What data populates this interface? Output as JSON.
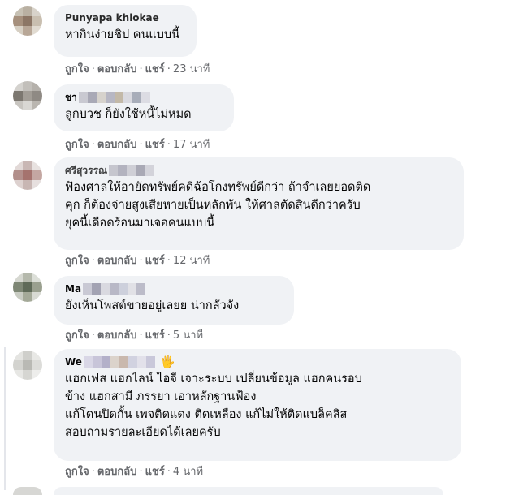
{
  "comments": [
    {
      "name_partial": "Punyapa khlokae",
      "text": "หากินง่ายชิป คนแบบนี้",
      "actions": {
        "like": "ถูกใจ",
        "reply": "ตอบกลับ",
        "share": "แชร์",
        "time": "23 นาที",
        "sep": "·"
      }
    },
    {
      "name_partial": "ชา",
      "text": "ลูกบวช ก็ยังใช้หนี้ไม่หมด",
      "actions": {
        "like": "ถูกใจ",
        "reply": "ตอบกลับ",
        "share": "แชร์",
        "time": "17 นาที",
        "sep": "·"
      }
    },
    {
      "name_partial": "ศรีสุวรรณ",
      "text": "ฟ้องศาลให้อายัดทรัพย์คดีฉ้อโกงทรัพย์ดีกว่า ถ้าจำเลยยอดติด\nคุก ก็ต้องจ่ายสูงเสียหายเป็นหลักพัน ให้ศาลตัดสินดีกว่าครับ\nยุคนี้เดือดร้อนมาเจอคนแบบนี้",
      "actions": {
        "like": "ถูกใจ",
        "reply": "ตอบกลับ",
        "share": "แชร์",
        "time": "12 นาที",
        "sep": "·"
      }
    },
    {
      "name_partial": "Ma",
      "text": "ยังเห็นโพสต์ขายอยู่เลยย น่ากลัวจัง",
      "actions": {
        "like": "ถูกใจ",
        "reply": "ตอบกลับ",
        "share": "แชร์",
        "time": "5 นาที",
        "sep": "·"
      }
    },
    {
      "name_partial": "We",
      "text": "แฮกเฟส แฮกไลน์ ไอจี เจาะระบบ เปลี่ยนข้อมูล แฮกคนรอบ\nข้าง แฮกสามี ภรรยา เอาหลักฐานฟ้อง\nแก้โดนปิดกั้น เพจติดแดง ติดเหลือง แก้ไม่ให้ติดแบล็คลิส\nสอบถามรายละเอียดได้เลยครับ",
      "actions": {
        "like": "ถูกใจ",
        "reply": "ตอบกลับ",
        "share": "แชร์",
        "time": "4 นาที",
        "sep": "·"
      },
      "emoji": "🖐"
    }
  ]
}
